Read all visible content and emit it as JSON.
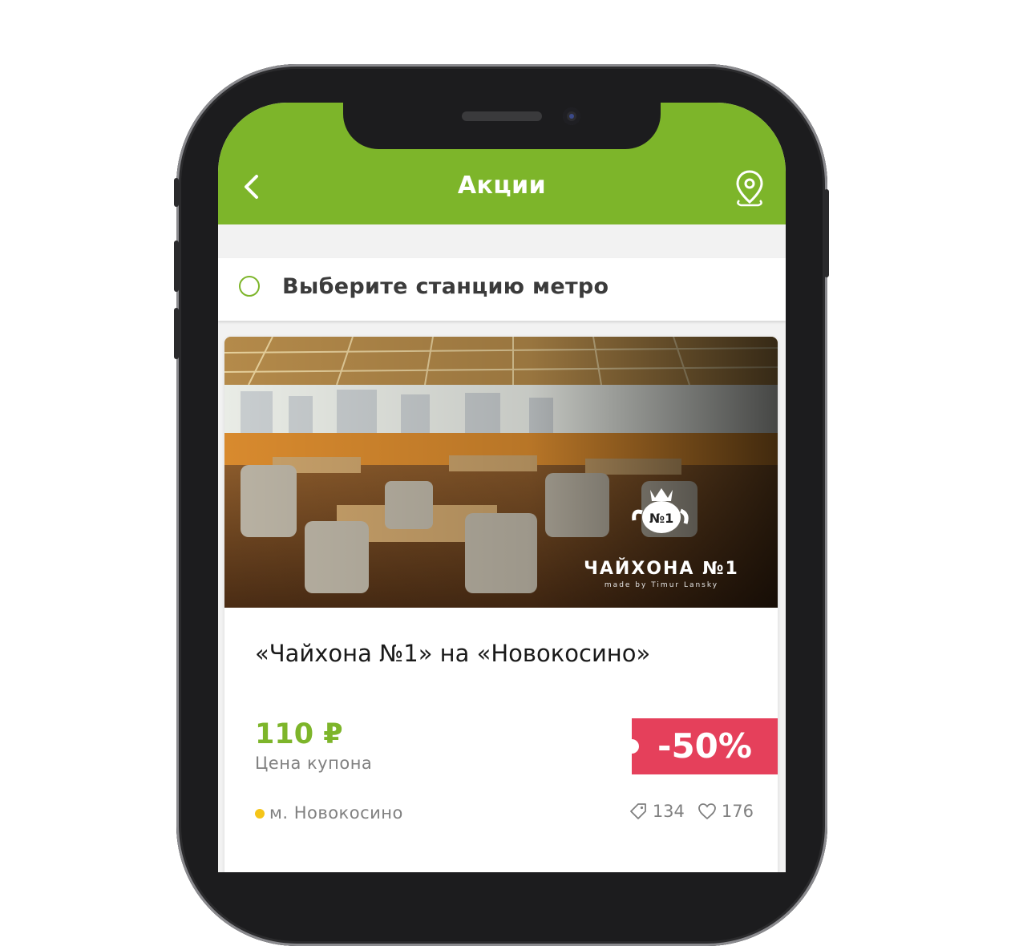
{
  "header": {
    "title": "Акции",
    "back_icon": "chevron-left-icon",
    "map_icon": "location-pin-icon"
  },
  "metro_filter": {
    "placeholder": "Выберите станцию метро"
  },
  "deal": {
    "title": "«Чайхона №1» на «Новокосино»",
    "logo_text": "ЧАЙХОНА №1",
    "logo_subtext": "made by Timur Lansky",
    "price": "110 ₽",
    "price_caption": "Цена купона",
    "discount": "-50%",
    "metro_station": "м. Новокосино",
    "coupons_count": "134",
    "likes_count": "176"
  },
  "colors": {
    "accent": "#7db52a",
    "discount": "#e5405b",
    "metro_line": "#f5c518"
  }
}
